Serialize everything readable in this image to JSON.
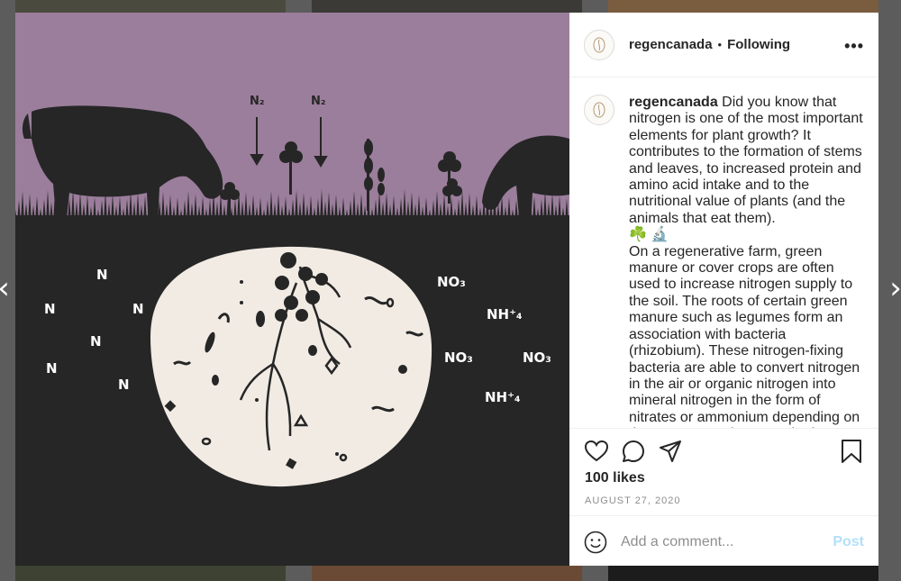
{
  "post": {
    "username": "regencanada",
    "separator": "•",
    "follow_status": "Following",
    "more_options": "•••"
  },
  "caption": {
    "username": "regencanada",
    "paragraph1": "Did you know that nitrogen is one of the most important elements for plant growth? It contributes to the formation of stems and leaves, to increased protein and amino acid intake and to the nutritional value of plants (and the animals that eat them).",
    "emoji": "☘️ 🔬",
    "paragraph2": "On a regenerative farm, green manure or cover crops are often used to increase nitrogen supply to the soil. The roots of certain green manure such as legumes form an association with bacteria (rhizobium). These nitrogen-fixing bacteria are able to convert nitrogen in the air or organic nitrogen into mineral nitrogen in the form of nitrates or ammonium depending on the crop. Sometimes synthetic nitrogen"
  },
  "engagement": {
    "likes": "100 likes",
    "date": "AUGUST 27, 2020"
  },
  "comment_box": {
    "placeholder": "Add a comment...",
    "post_label": "Post"
  },
  "nav": {
    "prev": "‹",
    "next": "›"
  },
  "illustration": {
    "air_labels": [
      "N₂",
      "N₂"
    ],
    "n_labels": [
      "N",
      "N",
      "N",
      "N",
      "N",
      "N"
    ],
    "right_labels": [
      "NO₃",
      "NH⁺₄",
      "NO₃",
      "NO₃",
      "NH⁺₄"
    ]
  },
  "colors": {
    "sky": "#9b7e9b",
    "ground": "#262626",
    "soil_disc": "#f1ebe4",
    "silhouette": "#262626",
    "label": "#ffffff",
    "post_button": "#b2dffc"
  }
}
